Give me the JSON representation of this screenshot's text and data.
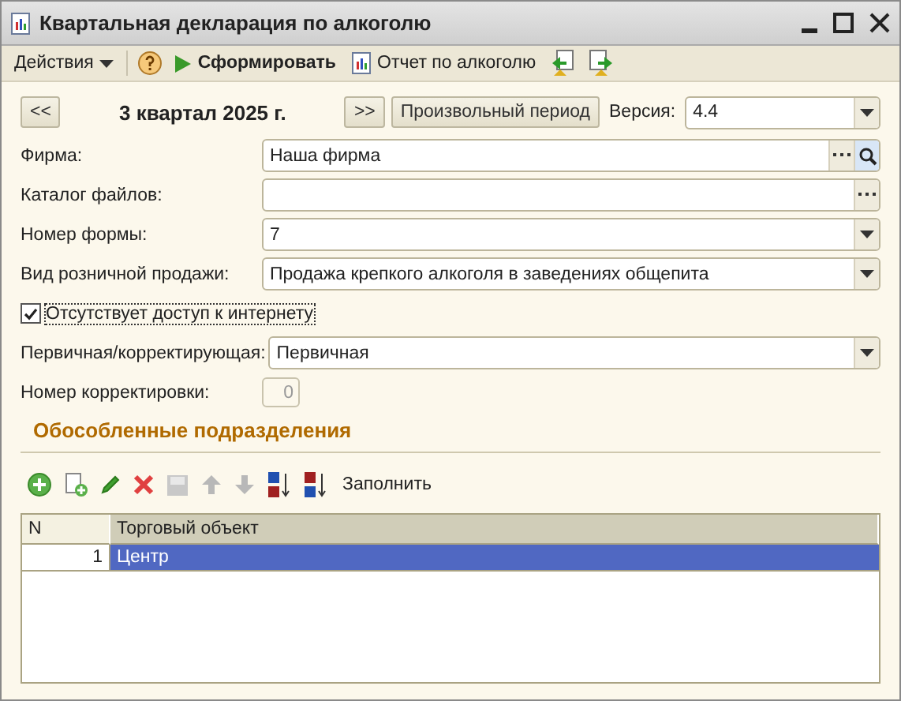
{
  "window": {
    "title": "Квартальная декларация по алкоголю"
  },
  "toolbar": [
    {
      "kind": "menu",
      "label": "Действия"
    },
    {
      "kind": "help"
    },
    {
      "kind": "run",
      "label": "Сформировать"
    },
    {
      "kind": "report",
      "label": "Отчет по алкоголю"
    },
    {
      "kind": "load"
    },
    {
      "kind": "save"
    }
  ],
  "period": {
    "prev": "<<",
    "label": "3 квартал 2025 г.",
    "next": ">>",
    "custom": "Произвольный период",
    "version_label": "Версия:",
    "version": "4.4"
  },
  "form": [
    {
      "kind": "choice",
      "label": "Фирма:",
      "value": "Наша фирма"
    },
    {
      "kind": "catalog",
      "label": "Каталог файлов:"
    },
    {
      "kind": "dropdown",
      "label": "Номер формы:",
      "value": "7"
    },
    {
      "kind": "dropdown",
      "label": "Вид розничной продажи:",
      "value": "Продажа крепкого алкоголя в заведениях общепита"
    },
    {
      "kind": "checkbox",
      "label": "Отсутствует доступ к интернету",
      "checked": true
    },
    {
      "kind": "dropdown",
      "label": "Первичная/корректирующая:",
      "value": "Первичная"
    },
    {
      "kind": "number",
      "label": "Номер корректировки:",
      "value": "0",
      "disabled": true
    }
  ],
  "section": {
    "title": "Обособленные подразделения",
    "fill_button": "Заполнить"
  },
  "table": {
    "columns": [
      "N",
      "Торговый объект"
    ],
    "rows": [
      {
        "cells": [
          "1",
          "Центр"
        ],
        "selected": true
      }
    ]
  }
}
